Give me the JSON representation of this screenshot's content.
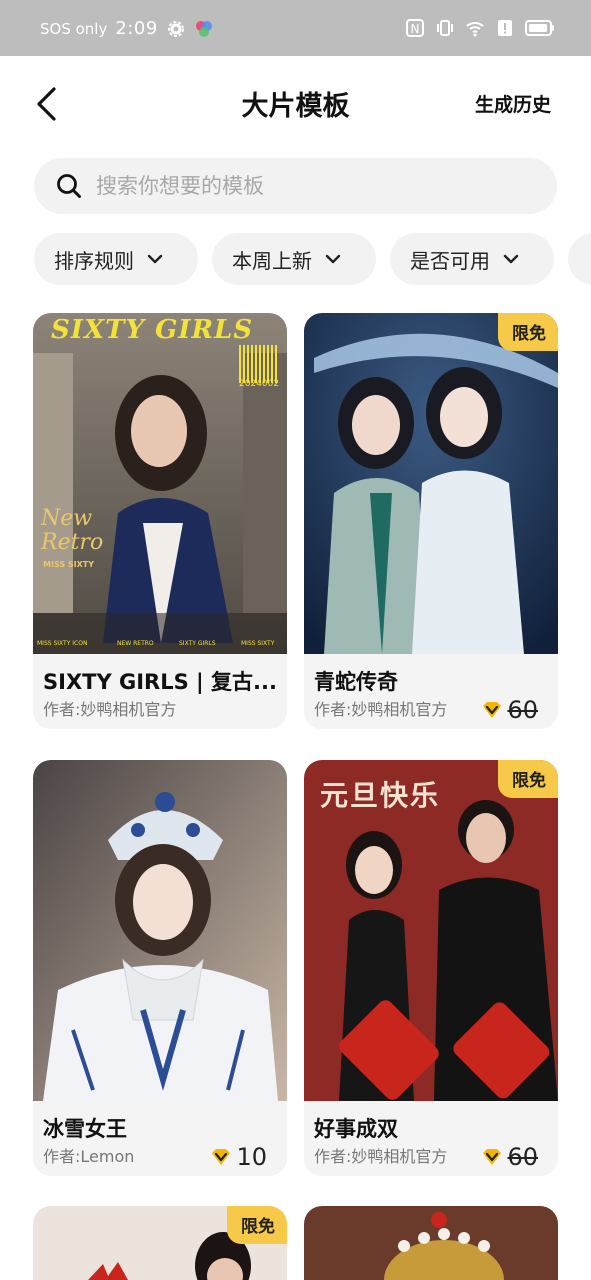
{
  "status": {
    "sos": "SOS only",
    "time": "2:09"
  },
  "header": {
    "title": "大片模板",
    "history": "生成历史"
  },
  "search": {
    "placeholder": "搜索你想要的模板"
  },
  "filters": [
    {
      "label": "排序规则"
    },
    {
      "label": "本周上新"
    },
    {
      "label": "是否可用"
    }
  ],
  "cards": [
    {
      "title": "SIXTY GIRLS | 复古...",
      "author": "作者:妙鸭相机官方",
      "badge": "",
      "price": "",
      "cover_text": {
        "headline": "SIXTY GIRLS",
        "barcode_number": "2024002",
        "script_line_1": "New",
        "script_line_2": "Retro",
        "tag": "MISS SIXTY",
        "footer_left": "MISS SIXTY ICON",
        "footer_mid_1": "NEW RETRO",
        "footer_mid_2": "SIXTY GIRLS",
        "footer_right": "MISS SIXTY"
      }
    },
    {
      "title": "青蛇传奇",
      "author": "作者:妙鸭相机官方",
      "badge": "限免",
      "price": "60",
      "price_strike": true
    },
    {
      "title": "冰雪女王",
      "author": "作者:Lemon",
      "badge": "",
      "price": "10",
      "price_strike": false
    },
    {
      "title": "好事成双",
      "author": "作者:妙鸭相机官方",
      "badge": "限免",
      "price": "60",
      "price_strike": true,
      "cover_text": {
        "headline": "元旦快乐"
      }
    },
    {
      "title": "",
      "author": "",
      "badge": "限免",
      "price": ""
    },
    {
      "title": "",
      "author": "",
      "badge": "",
      "price": ""
    }
  ],
  "colors": {
    "status_bar": "#bdbdbd",
    "badge": "#f7c948",
    "coin": "#f2b705",
    "chip_bg": "#f2f2f2",
    "card_info_bg": "#f4f4f4"
  }
}
